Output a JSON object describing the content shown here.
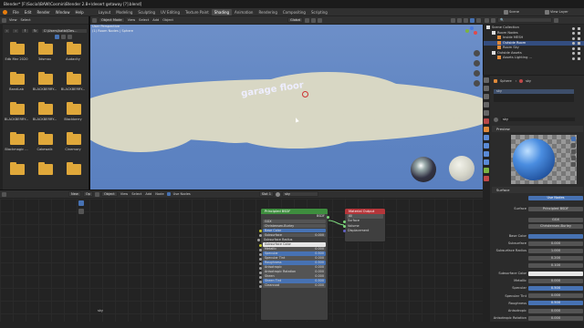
{
  "window": {
    "title": "Blender* [F:\\Social\\BAW\\Cosmin\\Blender 2.8+\\desert getaway [?].blend]"
  },
  "top_menu": {
    "items": [
      "File",
      "Edit",
      "Render",
      "Window",
      "Help"
    ]
  },
  "workspaces": {
    "items": [
      "Layout",
      "Modeling",
      "Sculpting",
      "UV Editing",
      "Texture Paint",
      "Shading",
      "Animation",
      "Rendering",
      "Compositing",
      "Scripting"
    ],
    "active": "Shading"
  },
  "scene": {
    "label": "Scene",
    "view_layer": "View Layer"
  },
  "file_browser": {
    "path": "C:\\Users\\katbi\\Des...",
    "items": [
      {
        "name": "Edb Mar 2020"
      },
      {
        "name": "3dsmax"
      },
      {
        "name": "Audacity"
      },
      {
        "name": "BandLab"
      },
      {
        "name": "BLACKBERRY..."
      },
      {
        "name": "BLACKBERRY..."
      },
      {
        "name": "BLACKBERRY..."
      },
      {
        "name": "BLACKBERRY..."
      },
      {
        "name": "Blackberry"
      },
      {
        "name": "Blackmagic ..."
      },
      {
        "name": "Cakewalk"
      },
      {
        "name": "Cinemory"
      },
      {
        "name": ""
      },
      {
        "name": ""
      },
      {
        "name": ""
      }
    ]
  },
  "viewport": {
    "header": {
      "mode": "Object Mode",
      "menus": [
        "View",
        "Select",
        "Add",
        "Object"
      ],
      "orientation": "Global"
    },
    "info_line1": "User Perspective",
    "info_line2": "(1) Room Nodes | Sphere"
  },
  "node_editor": {
    "header": {
      "editor": "Object",
      "menus": [
        "View",
        "Select",
        "Add",
        "Node"
      ],
      "use_nodes": "Use Nodes",
      "slot": "Slot 1",
      "material": "sky"
    },
    "corner_label": "sky",
    "principled": {
      "title": "Principled BSDF",
      "output": "BSDF",
      "dropdown1": "GGX",
      "dropdown2": "Christensen-Burley",
      "rows": [
        {
          "label": "Base Color",
          "value": "",
          "kind": "blue"
        },
        {
          "label": "Subsurface",
          "value": "0.000",
          "kind": "field"
        },
        {
          "label": "Subsurface Radius",
          "value": "",
          "kind": "label"
        },
        {
          "label": "Subsurface Color",
          "value": "",
          "kind": "white"
        },
        {
          "label": "Metallic",
          "value": "0.000",
          "kind": "field"
        },
        {
          "label": "Specular",
          "value": "0.500",
          "kind": "blue"
        },
        {
          "label": "Specular Tint",
          "value": "0.000",
          "kind": "field"
        },
        {
          "label": "Roughness",
          "value": "0.500",
          "kind": "blue"
        },
        {
          "label": "Anisotropic",
          "value": "0.000",
          "kind": "field"
        },
        {
          "label": "Anisotropic Rotation",
          "value": "0.000",
          "kind": "field"
        },
        {
          "label": "Sheen",
          "value": "0.000",
          "kind": "field"
        },
        {
          "label": "Sheen Tint",
          "value": "0.500",
          "kind": "blue"
        },
        {
          "label": "Clearcoat",
          "value": "0.000",
          "kind": "field"
        }
      ]
    },
    "material_output": {
      "title": "Material Output",
      "target": "All",
      "inputs": [
        "Surface",
        "Volume",
        "Displacement"
      ]
    }
  },
  "outliner": {
    "rows": [
      {
        "label": "Scene Collection",
        "indent": 0,
        "selected": false
      },
      {
        "label": "Room Nodes",
        "indent": 1,
        "selected": false
      },
      {
        "label": "Inside MESH",
        "indent": 2,
        "selected": false
      },
      {
        "label": "Outside Room",
        "indent": 2,
        "selected": true
      },
      {
        "label": "Room Sky",
        "indent": 2,
        "selected": false
      },
      {
        "label": "Outside Assets",
        "indent": 1,
        "selected": false
      },
      {
        "label": "Assets Lighting ...",
        "indent": 2,
        "selected": false
      }
    ]
  },
  "properties": {
    "object_name": "Sphere",
    "material_name": "sky",
    "slot_entry": "sky",
    "preview_label": "Preview",
    "surface_label": "Surface",
    "use_nodes": "Use Nodes",
    "surface_shader": "Principled BSDF",
    "dist1": "GGX",
    "dist2": "Christensen-Burley",
    "rows": [
      {
        "label": "Base Color",
        "value": "",
        "kind": "blue"
      },
      {
        "label": "Subsurface",
        "value": "0.000",
        "kind": "field"
      },
      {
        "label": "Subsurface Radius",
        "value": "1.000",
        "kind": "field"
      },
      {
        "label": "",
        "value": "0.200",
        "kind": "field"
      },
      {
        "label": "",
        "value": "0.100",
        "kind": "field"
      },
      {
        "label": "Subsurface Color",
        "value": "",
        "kind": "white"
      },
      {
        "label": "Metallic",
        "value": "0.000",
        "kind": "field"
      },
      {
        "label": "Specular",
        "value": "0.500",
        "kind": "blue"
      },
      {
        "label": "Specular Tint",
        "value": "0.000",
        "kind": "field"
      },
      {
        "label": "Roughness",
        "value": "0.500",
        "kind": "blue"
      },
      {
        "label": "Anisotropic",
        "value": "0.000",
        "kind": "field"
      },
      {
        "label": "Anisotropic Rotation",
        "value": "0.000",
        "kind": "field"
      }
    ]
  },
  "cloud_text": "garage floor",
  "colors": {
    "sky": "#5e84c2",
    "cloud": "#d8d7c4",
    "folder": "#e0a83a",
    "accent": "#4772b3",
    "node_green": "#3e8e3e",
    "node_red": "#b5363a"
  }
}
